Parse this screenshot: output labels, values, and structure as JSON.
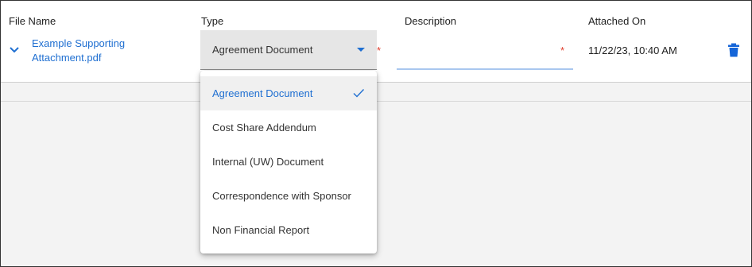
{
  "table": {
    "headers": {
      "file_name": "File Name",
      "type": "Type",
      "description": "Description",
      "attached_on": "Attached On"
    },
    "row": {
      "file_name": "Example Supporting Attachment.pdf",
      "type_value": "Agreement Document",
      "description_value": "",
      "attached_on": "11/22/23, 10:40 AM",
      "required_mark": "*"
    }
  },
  "type_dropdown": {
    "options": [
      {
        "label": "Agreement Document",
        "selected": true
      },
      {
        "label": "Cost Share Addendum",
        "selected": false
      },
      {
        "label": "Internal (UW) Document",
        "selected": false
      },
      {
        "label": "Correspondence with Sponsor",
        "selected": false
      },
      {
        "label": "Non Financial Report",
        "selected": false
      }
    ]
  },
  "icons": {
    "expand": "chevron-down-icon",
    "dropdown_arrow": "caret-down-icon",
    "selected": "check-icon",
    "delete": "trash-icon"
  },
  "colors": {
    "link": "#1f6fd1",
    "required": "#e0402f",
    "select_background": "#e6e6e6",
    "description_underline": "#a9c7ef"
  }
}
